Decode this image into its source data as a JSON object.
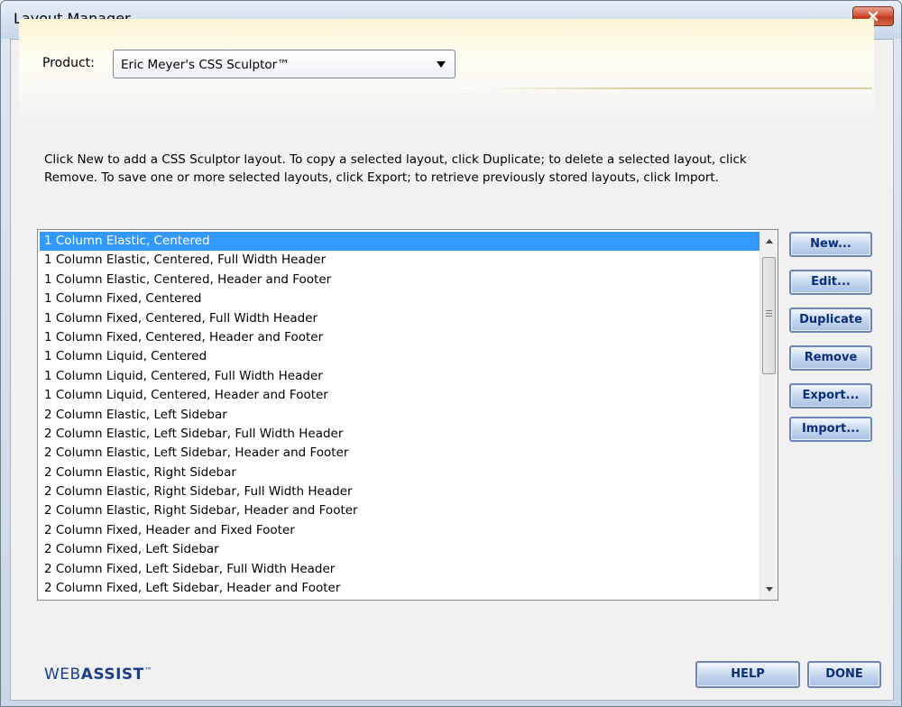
{
  "window": {
    "title": "Layout Manager"
  },
  "product": {
    "label": "Product:",
    "selected": "Eric Meyer's CSS Sculptor™"
  },
  "instructions": "Click New to add a CSS Sculptor layout. To copy a selected layout, click Duplicate; to delete a selected layout, click Remove. To save one or more selected layouts, click Export; to retrieve previously stored layouts, click Import.",
  "layouts": [
    "1 Column Elastic, Centered",
    "1 Column Elastic, Centered, Full Width Header",
    "1 Column Elastic, Centered, Header and Footer",
    "1 Column Fixed, Centered",
    "1 Column Fixed, Centered, Full Width Header",
    "1 Column Fixed, Centered, Header and Footer",
    "1 Column Liquid, Centered",
    "1 Column Liquid, Centered, Full Width Header",
    "1 Column Liquid, Centered, Header and Footer",
    "2 Column Elastic, Left Sidebar",
    "2 Column Elastic, Left Sidebar, Full Width Header",
    "2 Column Elastic, Left Sidebar, Header and Footer",
    "2 Column Elastic, Right Sidebar",
    "2 Column Elastic, Right Sidebar, Full Width Header",
    "2 Column Elastic, Right Sidebar, Header and Footer",
    "2 Column Fixed, Header and Fixed Footer",
    "2 Column Fixed, Left Sidebar",
    "2 Column Fixed, Left Sidebar, Full Width Header",
    "2 Column Fixed, Left Sidebar, Header and Footer"
  ],
  "selected_index": 0,
  "buttons": {
    "new": "New...",
    "edit": "Edit...",
    "duplicate": "Duplicate",
    "remove": "Remove",
    "export": "Export...",
    "import": "Import..."
  },
  "footer": {
    "logo_thin": "WEB",
    "logo_bold": "ASSIST",
    "logo_tm": "™",
    "help": "HELP",
    "done": "DONE"
  },
  "colors": {
    "selection": "#3399ff",
    "button_text": "#0a2f7a",
    "logo": "#1a3e8a"
  }
}
